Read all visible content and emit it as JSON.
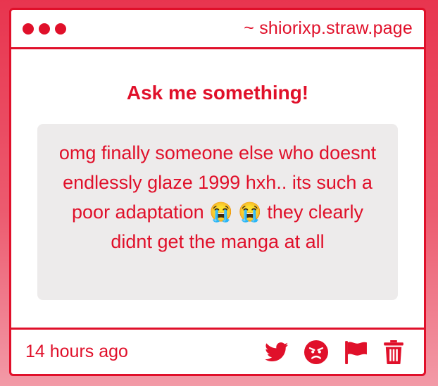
{
  "window": {
    "url": "~ shiorixp.straw.page"
  },
  "main": {
    "heading": "Ask me something!",
    "message": "omg finally someone else who doesnt endlessly glaze 1999 hxh.. its such a poor adaptation 😭 😭 they clearly didnt get the manga at all"
  },
  "footer": {
    "timestamp": "14 hours ago",
    "actions": [
      {
        "icon": "twitter-bird-icon"
      },
      {
        "icon": "angry-face-icon"
      },
      {
        "icon": "flag-icon"
      },
      {
        "icon": "trash-icon"
      }
    ]
  },
  "colors": {
    "accent": "#e0102a",
    "bubble_bg": "#edebeb",
    "background_top": "#e8354f",
    "background_bottom": "#f29aa7"
  }
}
